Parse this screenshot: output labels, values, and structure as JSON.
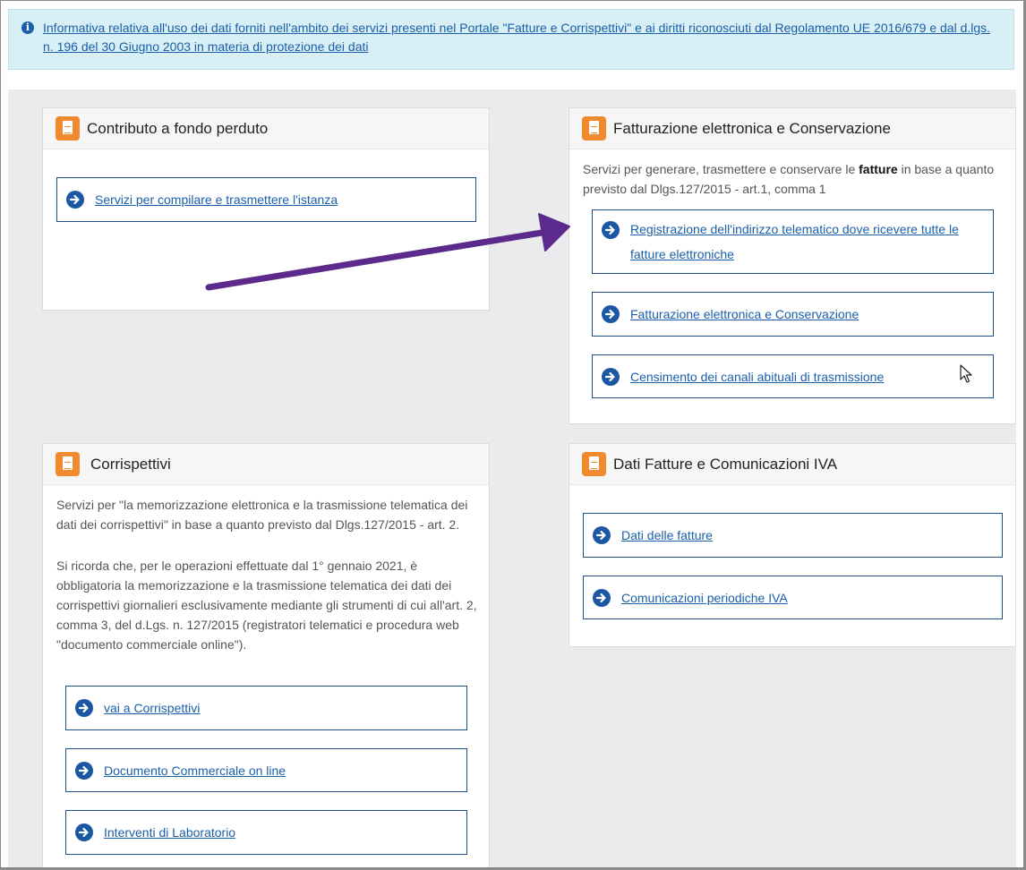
{
  "banner": {
    "text": "Informativa relativa all'uso dei dati forniti nell'ambito dei servizi presenti nel Portale \"Fatture e Corrispettivi\" e ai diritti riconosciuti dal Regolamento UE 2016/679 e dal d.lgs. n. 196 del 30 Giugno 2003 in materia di protezione dei dati",
    "icon": "info-icon"
  },
  "cards": {
    "contributo": {
      "title": "Contributo a fondo perduto",
      "links": [
        "Servizi per compilare e trasmettere l'istanza"
      ]
    },
    "fatturazione": {
      "title": "Fatturazione elettronica e Conservazione",
      "desc_pre": "Servizi per generare, trasmettere e conservare le ",
      "desc_bold": "fatture",
      "desc_post": " in base a quanto previsto dal Dlgs.127/2015 - art.1, comma 1",
      "links": [
        "Registrazione dell'indirizzo telematico dove ricevere tutte le fatture elettroniche",
        "Fatturazione elettronica e Conservazione",
        "Censimento dei canali abituali di trasmissione"
      ]
    },
    "corrispettivi": {
      "title": "Corrispettivi",
      "desc1": "Servizi per \"la memorizzazione elettronica e la trasmissione telematica dei dati dei corrispettivi\" in base a quanto previsto dal Dlgs.127/2015 - art. 2.",
      "desc2": "Si ricorda che, per le operazioni effettuate dal 1° gennaio 2021, è obbligatoria la memorizzazione e la trasmissione telematica dei dati dei corrispettivi giornalieri esclusivamente mediante gli strumenti di cui all'art. 2, comma 3, del d.Lgs. n. 127/2015 (registratori telematici e procedura web \"documento commerciale online\").",
      "links": [
        "vai a Corrispettivi",
        "Documento Commerciale on line",
        "Interventi di Laboratorio"
      ]
    },
    "dati_fatture": {
      "title": "Dati Fatture e Comunicazioni IVA",
      "links": [
        "Dati delle fatture",
        "Comunicazioni periodiche IVA"
      ]
    }
  },
  "colors": {
    "accent_orange": "#f18a2e",
    "link_blue": "#1a5fa8",
    "annotation_purple": "#5b2a8c"
  }
}
